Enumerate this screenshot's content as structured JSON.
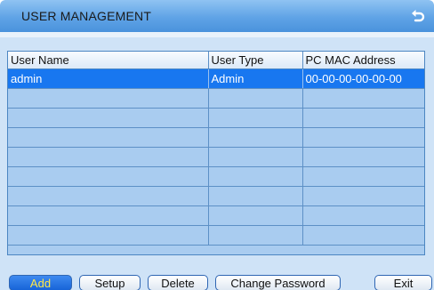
{
  "window": {
    "title": "USER MANAGEMENT",
    "back_icon": "undo-arrow-icon"
  },
  "table": {
    "columns": [
      "User Name",
      "User Type",
      "PC MAC Address"
    ],
    "rows": [
      {
        "user_name": "admin",
        "user_type": "Admin",
        "mac": "00-00-00-00-00-00",
        "selected": true
      },
      {
        "user_name": "",
        "user_type": "",
        "mac": ""
      },
      {
        "user_name": "",
        "user_type": "",
        "mac": ""
      },
      {
        "user_name": "",
        "user_type": "",
        "mac": ""
      },
      {
        "user_name": "",
        "user_type": "",
        "mac": ""
      },
      {
        "user_name": "",
        "user_type": "",
        "mac": ""
      },
      {
        "user_name": "",
        "user_type": "",
        "mac": ""
      },
      {
        "user_name": "",
        "user_type": "",
        "mac": ""
      },
      {
        "user_name": "",
        "user_type": "",
        "mac": ""
      }
    ]
  },
  "buttons": {
    "add": "Add",
    "setup": "Setup",
    "delete": "Delete",
    "change_password": "Change Password",
    "exit": "Exit"
  },
  "colors": {
    "titlebar": "#5fa3e6",
    "selected_row": "#1877f0",
    "table_bg": "#a9ccf0",
    "active_button_text": "#ffe94a"
  }
}
